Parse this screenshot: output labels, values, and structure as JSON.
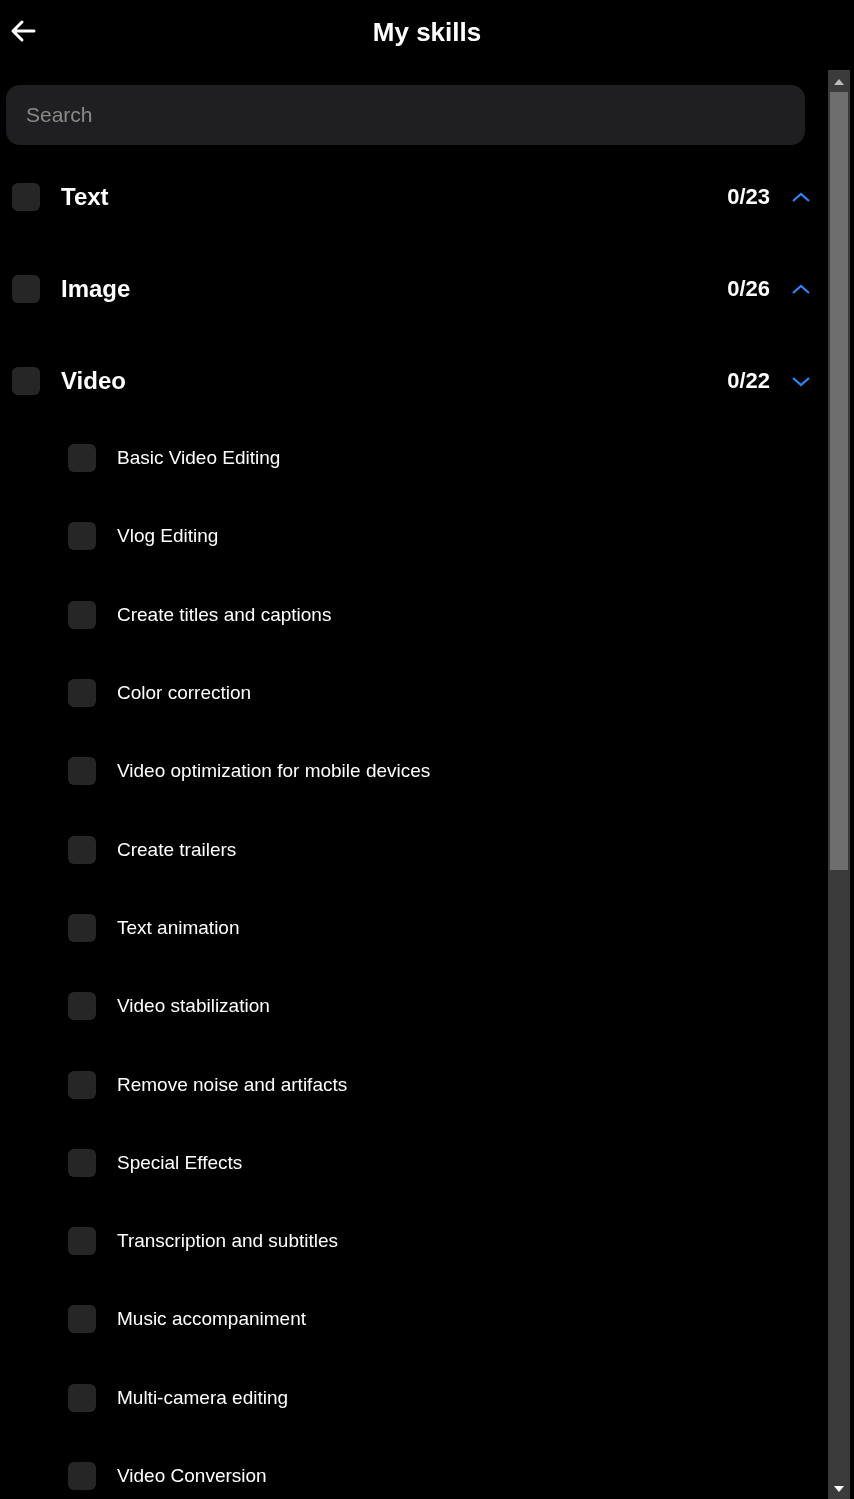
{
  "header": {
    "title": "My skills"
  },
  "search": {
    "placeholder": "Search"
  },
  "categories": [
    {
      "label": "Text",
      "count": "0/23",
      "checked": false,
      "expanded": false
    },
    {
      "label": "Image",
      "count": "0/26",
      "checked": false,
      "expanded": false
    },
    {
      "label": "Video",
      "count": "0/22",
      "checked": false,
      "expanded": true,
      "children": [
        {
          "label": "Basic Video Editing",
          "checked": false
        },
        {
          "label": "Vlog Editing",
          "checked": false
        },
        {
          "label": "Create titles and captions",
          "checked": false
        },
        {
          "label": "Color correction",
          "checked": false
        },
        {
          "label": "Video optimization for mobile devices",
          "checked": false
        },
        {
          "label": "Create trailers",
          "checked": false
        },
        {
          "label": "Text animation",
          "checked": false
        },
        {
          "label": "Video stabilization",
          "checked": false
        },
        {
          "label": "Remove noise and artifacts",
          "checked": false
        },
        {
          "label": "Special Effects",
          "checked": false
        },
        {
          "label": "Transcription and subtitles",
          "checked": false
        },
        {
          "label": "Music accompaniment",
          "checked": false
        },
        {
          "label": "Multi-camera editing",
          "checked": false
        },
        {
          "label": "Video Conversion",
          "checked": false
        }
      ]
    }
  ]
}
